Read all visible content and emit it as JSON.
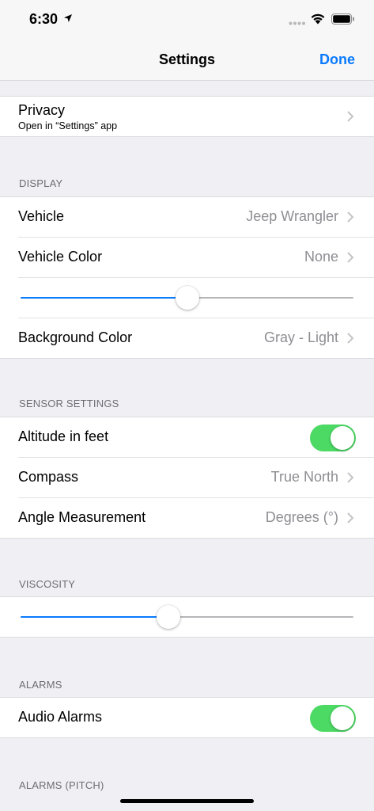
{
  "status": {
    "time": "6:30"
  },
  "nav": {
    "title": "Settings",
    "done": "Done"
  },
  "privacy": {
    "label": "Privacy",
    "subtitle": "Open in “Settings” app"
  },
  "display": {
    "header": "DISPLAY",
    "vehicle": {
      "label": "Vehicle",
      "value": "Jeep Wrangler"
    },
    "vehicle_color": {
      "label": "Vehicle Color",
      "value": "None"
    },
    "vehicle_color_slider": 0.5,
    "background_color": {
      "label": "Background Color",
      "value": "Gray - Light"
    }
  },
  "sensor": {
    "header": "SENSOR SETTINGS",
    "altitude": {
      "label": "Altitude in feet",
      "on": true
    },
    "compass": {
      "label": "Compass",
      "value": "True North"
    },
    "angle": {
      "label": "Angle Measurement",
      "value": "Degrees (°)"
    }
  },
  "viscosity": {
    "header": "VISCOSITY",
    "slider": 0.445
  },
  "alarms": {
    "header": "ALARMS",
    "audio": {
      "label": "Audio Alarms",
      "on": true
    }
  },
  "alarms_pitch": {
    "header": "ALARMS (PITCH)"
  },
  "colors": {
    "accent": "#0a7aff",
    "toggle_on": "#4cd964",
    "background": "#efeff4"
  }
}
